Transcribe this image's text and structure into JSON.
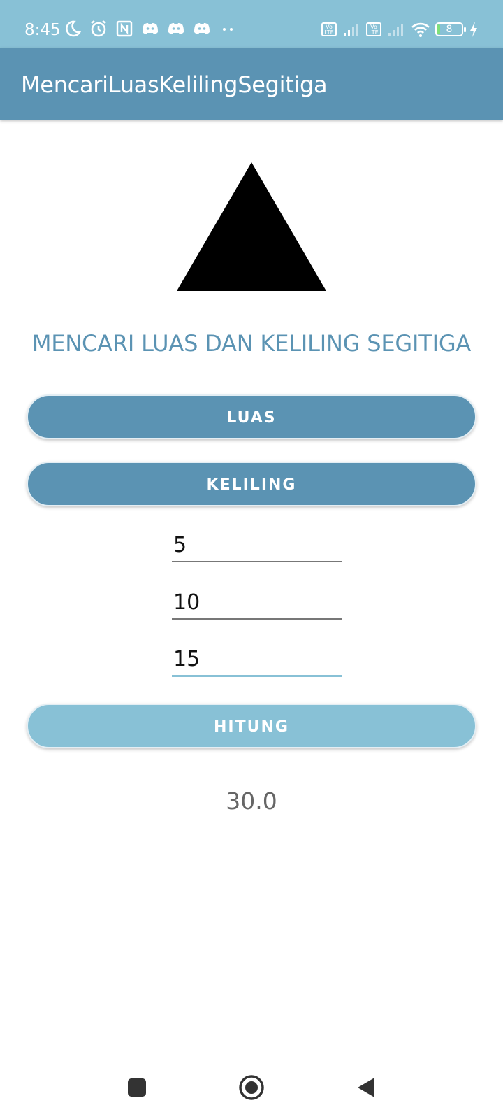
{
  "status_bar": {
    "time": "8:45",
    "volte_label": "Vo LTE",
    "battery_level": "8",
    "left_icons": [
      "moon-icon",
      "alarm-icon",
      "nfc-icon",
      "discord-icon",
      "discord-icon",
      "discord-icon",
      "more-dots-icon"
    ],
    "right_icons": [
      "volte-icon",
      "signal-icon",
      "volte-icon",
      "signal-icon",
      "wifi-icon",
      "battery-icon",
      "charging-icon"
    ]
  },
  "app_bar": {
    "title": "MencariLuasKelilingSegitiga"
  },
  "main": {
    "heading": "MENCARI LUAS DAN KELILING SEGITIGA",
    "buttons": {
      "luas": "LUAS",
      "keliling": "KELILING",
      "hitung": "HITUNG"
    },
    "fields": [
      {
        "value": "5"
      },
      {
        "value": "10"
      },
      {
        "value": "15"
      }
    ],
    "result": "30.0"
  },
  "colors": {
    "status_bar": "#88c1d6",
    "app_bar": "#5b93b3",
    "primary_button": "#5b93b3",
    "accent_button": "#88c1d6",
    "heading_text": "#5b93b3"
  },
  "nav_bar": {
    "icons": [
      "recent-apps-icon",
      "home-icon",
      "back-icon"
    ]
  }
}
